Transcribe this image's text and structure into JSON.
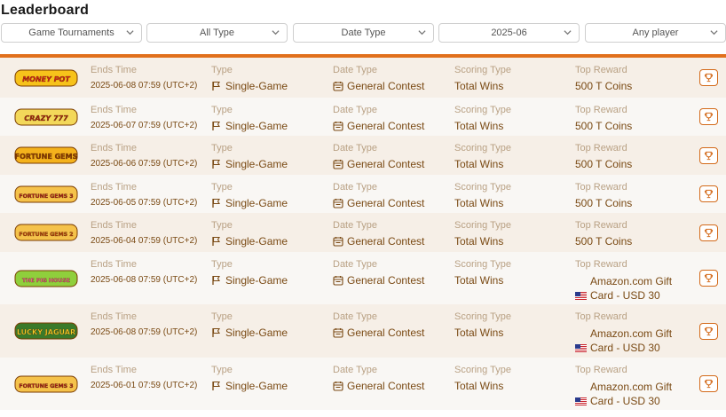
{
  "page": {
    "title": "Leaderboard"
  },
  "filters": [
    {
      "label": "Game Tournaments"
    },
    {
      "label": "All Type"
    },
    {
      "label": "Date Type"
    },
    {
      "label": "2025-06"
    },
    {
      "label": "Any player"
    }
  ],
  "labels": {
    "ends": "Ends Time",
    "type": "Type",
    "date_type": "Date Type",
    "scoring": "Scoring Type",
    "reward": "Top Reward"
  },
  "rows": [
    {
      "game": "MONEY POT",
      "ends": "2025-06-08 07:59 (UTC+2)",
      "type": "Single-Game",
      "date_type": "General Contest",
      "scoring": "Total Wins",
      "reward_line1": "500 T Coins",
      "reward_line2": "",
      "flag": false
    },
    {
      "game": "CRAZY 777",
      "ends": "2025-06-07 07:59 (UTC+2)",
      "type": "Single-Game",
      "date_type": "General Contest",
      "scoring": "Total Wins",
      "reward_line1": "500 T Coins",
      "reward_line2": "",
      "flag": false
    },
    {
      "game": "FORTUNE GEMS",
      "ends": "2025-06-06 07:59 (UTC+2)",
      "type": "Single-Game",
      "date_type": "General Contest",
      "scoring": "Total Wins",
      "reward_line1": "500 T Coins",
      "reward_line2": "",
      "flag": false
    },
    {
      "game": "FORTUNE GEMS 3",
      "ends": "2025-06-05 07:59 (UTC+2)",
      "type": "Single-Game",
      "date_type": "General Contest",
      "scoring": "Total Wins",
      "reward_line1": "500 T Coins",
      "reward_line2": "",
      "flag": false
    },
    {
      "game": "FORTUNE GEMS 2",
      "ends": "2025-06-04 07:59 (UTC+2)",
      "type": "Single-Game",
      "date_type": "General Contest",
      "scoring": "Total Wins",
      "reward_line1": "500 T Coins",
      "reward_line2": "",
      "flag": false
    },
    {
      "game": "THE PIG HOUSE",
      "ends": "2025-06-08 07:59 (UTC+2)",
      "type": "Single-Game",
      "date_type": "General Contest",
      "scoring": "Total Wins",
      "reward_line1": "Amazon.com Gift",
      "reward_line2": "Card - USD 30",
      "flag": true
    },
    {
      "game": "LUCKY JAGUAR",
      "ends": "2025-06-08 07:59 (UTC+2)",
      "type": "Single-Game",
      "date_type": "General Contest",
      "scoring": "Total Wins",
      "reward_line1": "Amazon.com Gift",
      "reward_line2": "Card - USD 30",
      "flag": true
    },
    {
      "game": "FORTUNE GEMS 3",
      "ends": "2025-06-01 07:59 (UTC+2)",
      "type": "Single-Game",
      "date_type": "General Contest",
      "scoring": "Total Wins",
      "reward_line1": "Amazon.com Gift",
      "reward_line2": "Card - USD 30",
      "flag": true
    }
  ],
  "colors": {
    "accent": "#e1701c",
    "text": "#7a4a14",
    "label": "#b9a184",
    "row_odd": "#f6efe7",
    "row_even": "#f9f7f4"
  },
  "icons": {
    "filter_chevron": "chevron-down-icon",
    "type": "flag-icon",
    "date_type": "calendar-icon",
    "reward_flag": "us-flag-icon",
    "action": "trophy-icon"
  }
}
